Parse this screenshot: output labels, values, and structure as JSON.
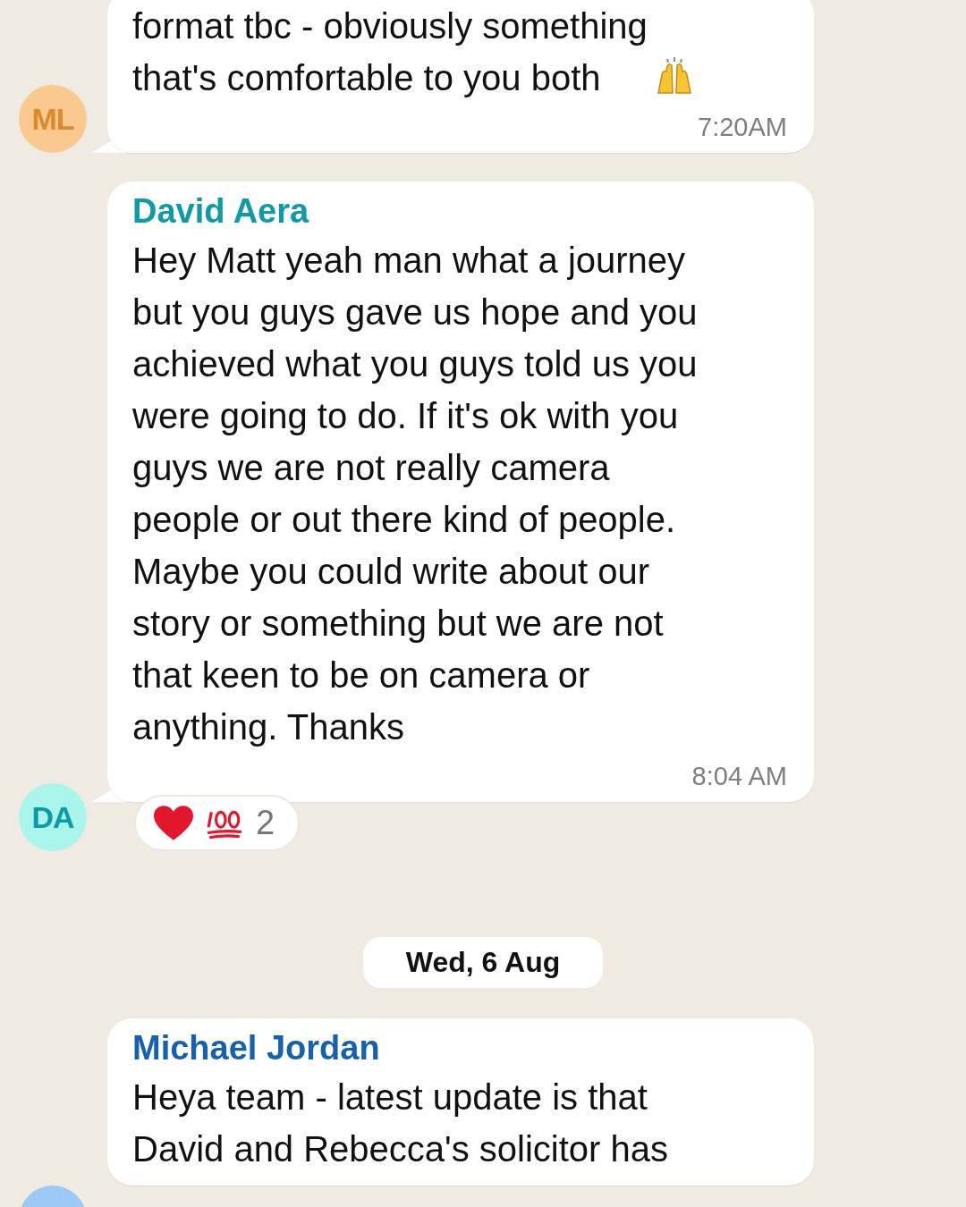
{
  "messages": [
    {
      "kind": "message",
      "avatar": {
        "initials": "ML",
        "color": "#f9c990"
      },
      "lines": [
        "format tbc - obviously something",
        "that's comfortable to you both"
      ],
      "trailing_icon": true,
      "time": "7:20AM",
      "tail": true
    },
    {
      "kind": "message",
      "avatar": {
        "initials": "DA",
        "color": "#a9f5ec"
      },
      "sender": {
        "name": "David Aera",
        "color": "#0e9aa7"
      },
      "lines": [
        "Hey Matt yeah man what a journey",
        "but you guys gave us hope and you",
        "achieved what you guys told us you",
        "were going to do. If it's ok with you",
        "guys we are not really camera",
        "people or out there kind of people.",
        "Maybe you could write about our",
        "story or something but we are not",
        "that keen to be on camera or",
        "anything. Thanks"
      ],
      "time": "8:04 AM",
      "tail": true,
      "reactions": {
        "count": "2"
      }
    },
    {
      "kind": "date",
      "label": "Wed, 6 Aug"
    },
    {
      "kind": "message",
      "avatar": {
        "color": "#9cc8f5"
      },
      "sender": {
        "name": "Michael Jordan",
        "color": "#1561b0"
      },
      "lines": [
        "Heya team - latest update is that",
        "David and Rebecca's solicitor has"
      ],
      "tail": false
    }
  ]
}
